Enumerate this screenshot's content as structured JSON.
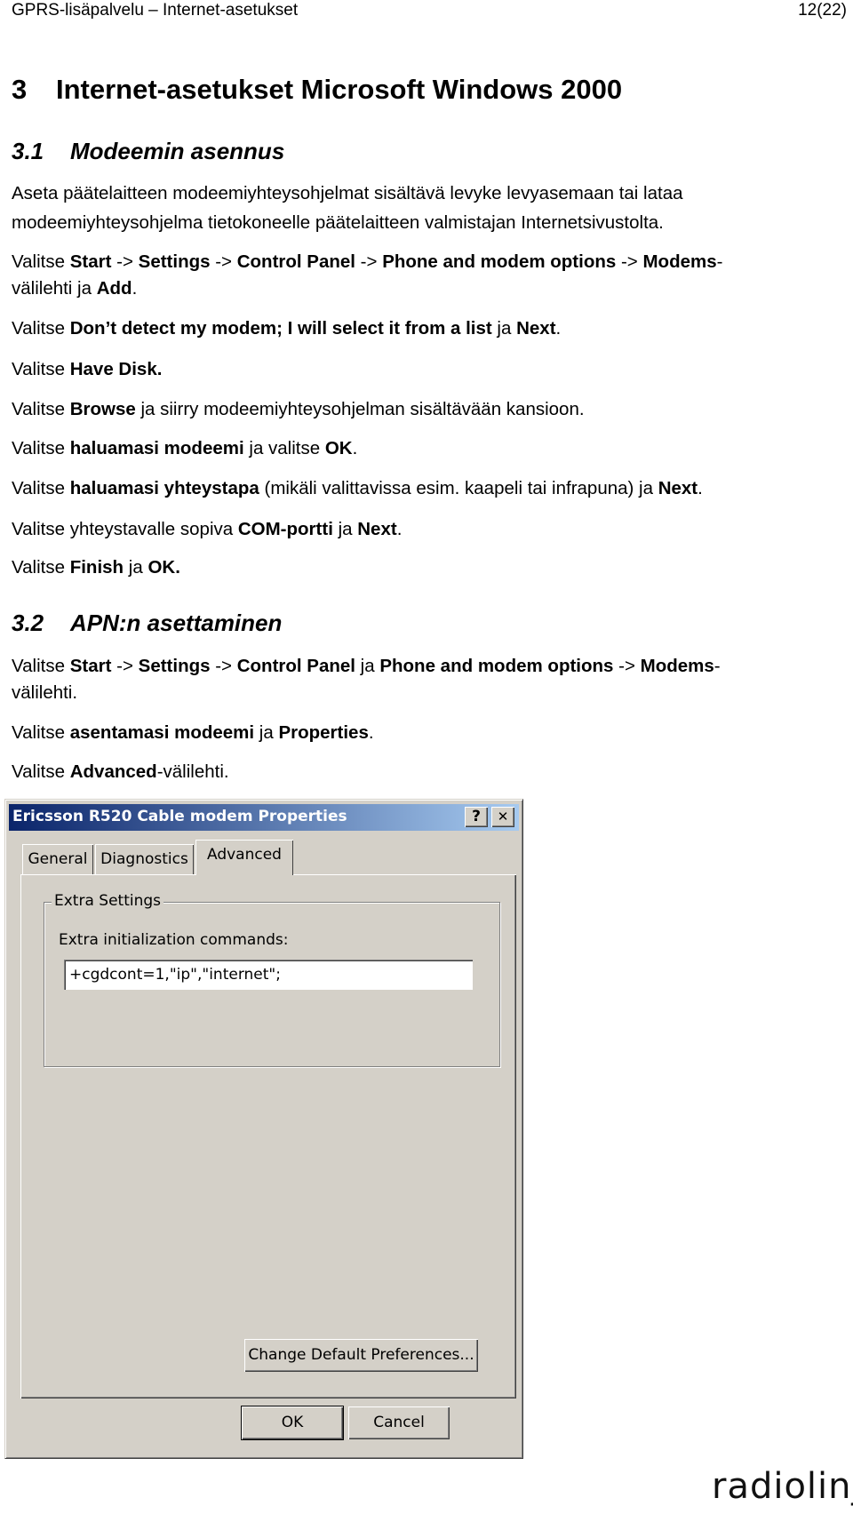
{
  "header": {
    "title": "GPRS-lisäpalvelu – Internet-asetukset",
    "page": "12(22)"
  },
  "section3": {
    "number": "3",
    "title": "Internet-asetukset Microsoft Windows 2000"
  },
  "section31": {
    "number": "3.1",
    "title": "Modeemin asennus"
  },
  "section32": {
    "number": "3.2",
    "title": "APN:n asettaminen"
  },
  "lines31": [
    [
      {
        "t": "Aseta päätelaitteen modeemiyhteysohjelmat sisältävä levyke levyasemaan tai lataa"
      }
    ],
    [
      {
        "t": "modeemiyhteysohjelma tietokoneelle päätelaitteen valmistajan Internetsivustolta."
      }
    ],
    [
      {
        "t": "Valitse "
      },
      {
        "t": "Start",
        "b": true
      },
      {
        "t": " -> "
      },
      {
        "t": "Settings",
        "b": true
      },
      {
        "t": " -> "
      },
      {
        "t": "Control Panel",
        "b": true
      },
      {
        "t": " -> "
      },
      {
        "t": "Phone and modem options",
        "b": true
      },
      {
        "t": " -> "
      },
      {
        "t": "Modems",
        "b": true
      },
      {
        "t": "-"
      }
    ],
    [
      {
        "t": "välilehti ja "
      },
      {
        "t": "Add",
        "b": true
      },
      {
        "t": "."
      }
    ],
    [
      {
        "t": "Valitse "
      },
      {
        "t": "Don’t detect my modem; I will select it from a list",
        "b": true
      },
      {
        "t": " ja "
      },
      {
        "t": "Next",
        "b": true
      },
      {
        "t": "."
      }
    ],
    [
      {
        "t": "Valitse "
      },
      {
        "t": "Have Disk.",
        "b": true
      }
    ],
    [
      {
        "t": "Valitse "
      },
      {
        "t": "Browse",
        "b": true
      },
      {
        "t": " ja siirry modeemiyhteysohjelman sisältävään kansioon."
      }
    ],
    [
      {
        "t": "Valitse "
      },
      {
        "t": "haluamasi modeemi",
        "b": true
      },
      {
        "t": " ja valitse "
      },
      {
        "t": "OK",
        "b": true
      },
      {
        "t": "."
      }
    ],
    [
      {
        "t": "Valitse "
      },
      {
        "t": "haluamasi yhteystapa",
        "b": true
      },
      {
        "t": " (mikäli valittavissa esim. kaapeli tai infrapuna) ja "
      },
      {
        "t": "Next",
        "b": true
      },
      {
        "t": "."
      }
    ],
    [
      {
        "t": "Valitse yhteystavalle sopiva "
      },
      {
        "t": "COM-portti",
        "b": true
      },
      {
        "t": " ja "
      },
      {
        "t": "Next",
        "b": true
      },
      {
        "t": "."
      }
    ],
    [
      {
        "t": "Valitse "
      },
      {
        "t": "Finish",
        "b": true
      },
      {
        "t": " ja "
      },
      {
        "t": "OK.",
        "b": true
      }
    ]
  ],
  "lines32": [
    [
      {
        "t": "Valitse "
      },
      {
        "t": "Start",
        "b": true
      },
      {
        "t": " -> "
      },
      {
        "t": "Settings",
        "b": true
      },
      {
        "t": " -> "
      },
      {
        "t": "Control Panel",
        "b": true
      },
      {
        "t": " ja "
      },
      {
        "t": "Phone and modem options",
        "b": true
      },
      {
        "t": " -> "
      },
      {
        "t": "Modems",
        "b": true
      },
      {
        "t": "-"
      }
    ],
    [
      {
        "t": "välilehti."
      }
    ],
    [
      {
        "t": "Valitse "
      },
      {
        "t": "asentamasi modeemi",
        "b": true
      },
      {
        "t": " ja "
      },
      {
        "t": "Properties",
        "b": true
      },
      {
        "t": "."
      }
    ],
    [
      {
        "t": "Valitse "
      },
      {
        "t": "Advanced",
        "b": true
      },
      {
        "t": "-välilehti."
      }
    ]
  ],
  "dialog": {
    "title": "Ericsson R520 Cable modem Properties",
    "help_label": "?",
    "close_label": "✕",
    "tabs": [
      {
        "label": "General"
      },
      {
        "label": "Diagnostics"
      },
      {
        "label": "Advanced",
        "selected": true
      }
    ],
    "group_title": "Extra Settings",
    "field_label": "Extra initialization commands:",
    "field_value": "+cgdcont=1,\"ip\",\"internet\";",
    "change_button": "Change Default Preferences...",
    "ok_button": "OK",
    "cancel_button": "Cancel",
    "colors": {
      "face": "#d4d0c8",
      "title_start": "#0a246a",
      "title_end": "#a6caf0"
    }
  },
  "logo": {
    "text": "radiolinja"
  }
}
